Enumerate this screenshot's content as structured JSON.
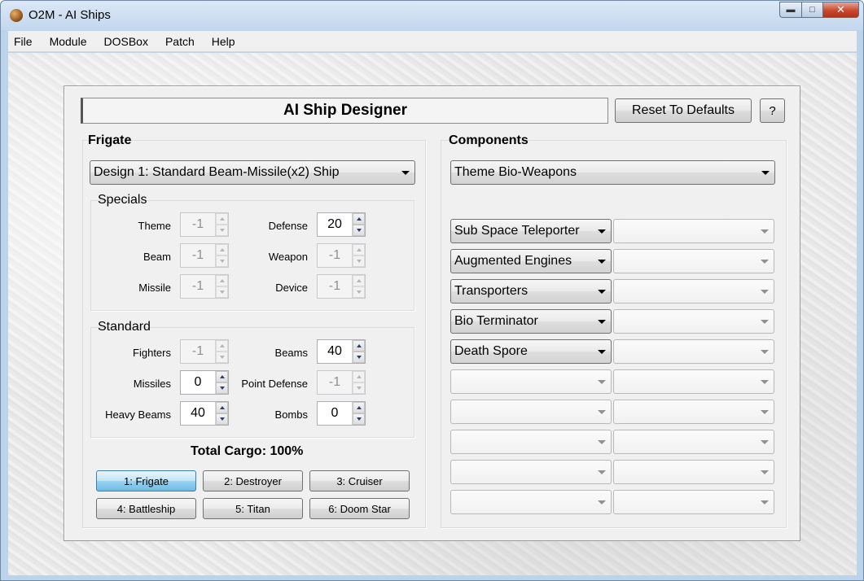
{
  "window": {
    "title": "O2M - AI Ships",
    "minimize": "▬",
    "maximize": "□",
    "close": "✕"
  },
  "menu": [
    "File",
    "Module",
    "DOSBox",
    "Patch",
    "Help"
  ],
  "designer": {
    "title": "AI Ship Designer",
    "reset_label": "Reset To Defaults",
    "help_label": "?"
  },
  "frigate": {
    "label": "Frigate",
    "design": "Design 1: Standard Beam-Missile(x2) Ship",
    "specials_label": "Specials",
    "standard_label": "Standard",
    "specials": [
      {
        "label": "Theme",
        "value": "-1",
        "enabled": false
      },
      {
        "label": "Defense",
        "value": "20",
        "enabled": true
      },
      {
        "label": "Beam",
        "value": "-1",
        "enabled": false
      },
      {
        "label": "Weapon",
        "value": "-1",
        "enabled": false
      },
      {
        "label": "Missile",
        "value": "-1",
        "enabled": false
      },
      {
        "label": "Device",
        "value": "-1",
        "enabled": false
      }
    ],
    "standard": [
      {
        "label": "Fighters",
        "value": "-1",
        "enabled": false
      },
      {
        "label": "Beams",
        "value": "40",
        "enabled": true
      },
      {
        "label": "Missiles",
        "value": "0",
        "enabled": true
      },
      {
        "label": "Point Defense",
        "value": "-1",
        "enabled": false
      },
      {
        "label": "Heavy Beams",
        "value": "40",
        "enabled": true
      },
      {
        "label": "Bombs",
        "value": "0",
        "enabled": true
      }
    ],
    "total_cargo": "Total Cargo: 100%",
    "ship_buttons": [
      "1: Frigate",
      "2: Destroyer",
      "3: Cruiser",
      "4: Battleship",
      "5: Titan",
      "6: Doom Star"
    ],
    "active_ship": 0
  },
  "components": {
    "label": "Components",
    "theme": "Theme Bio-Weapons",
    "left": [
      "Sub Space Teleporter",
      "Augmented Engines",
      "Transporters",
      "Bio Terminator",
      "Death Spore",
      "",
      "",
      "",
      "",
      ""
    ],
    "right": [
      "",
      "",
      "",
      "",
      "",
      "",
      "",
      "",
      "",
      ""
    ]
  }
}
